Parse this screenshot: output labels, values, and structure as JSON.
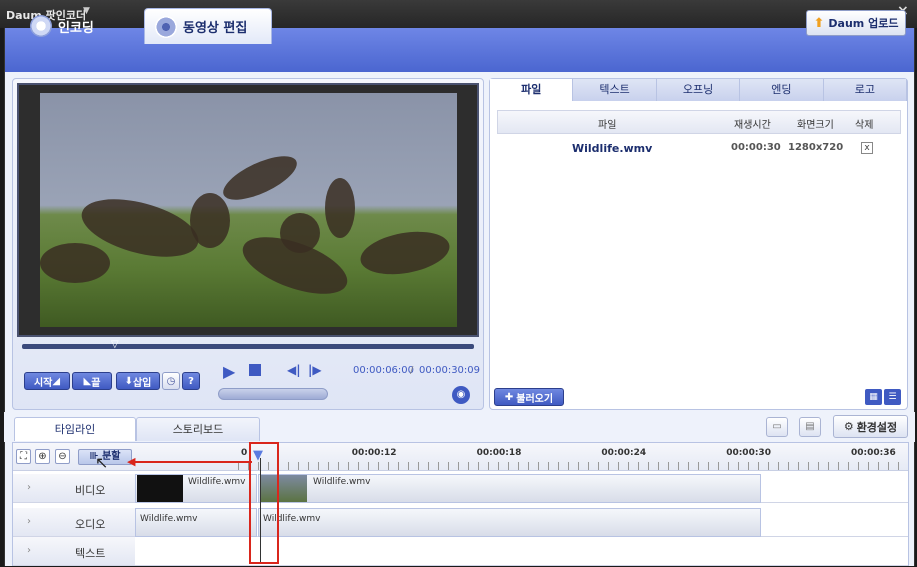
{
  "window": {
    "title": "Daum 팟인코더"
  },
  "tabs": {
    "encoding": "인코딩",
    "edit": "동영상 편집"
  },
  "upload_button": "Daum 업로드",
  "player": {
    "start_label": "시작",
    "end_label": "끝",
    "insert_label": "삽입",
    "help_label": "?",
    "current_time": "00:00:06:00",
    "separator": "/",
    "total_time": "00:00:30:09"
  },
  "right_tabs": [
    "파일",
    "텍스트",
    "오프닝",
    "엔딩",
    "로고"
  ],
  "file_list": {
    "columns": {
      "file": "파일",
      "duration": "재생시간",
      "resolution": "화면크기",
      "delete": "삭제"
    },
    "rows": [
      {
        "file": "Wildlife.wmv",
        "duration": "00:00:30",
        "resolution": "1280x720",
        "delete": "x"
      }
    ]
  },
  "load_button": "불러오기",
  "bottom_tabs": {
    "timeline": "타임라인",
    "storyboard": "스토리보드"
  },
  "settings_button": "환경설정",
  "timeline_toolbar": {
    "split_label": "분할"
  },
  "ruler_ticks": [
    "0",
    "00:00:12",
    "00:00:18",
    "00:00:24",
    "00:00:30",
    "00:00:36"
  ],
  "ruler_tick_values": [
    6,
    12,
    18,
    24,
    30,
    36
  ],
  "tracks": {
    "video": "비디오",
    "audio": "오디오",
    "text": "텍스트"
  },
  "clips": {
    "video_a": "Wildlife.wmv",
    "video_b": "Wildlife.wmv",
    "audio_a": "Wildlife.wmv",
    "audio_b": "Wildlife.wmv"
  },
  "colors": {
    "accent": "#3f5ac2",
    "highlight": "#d9261c",
    "header": "#4b66d0"
  }
}
